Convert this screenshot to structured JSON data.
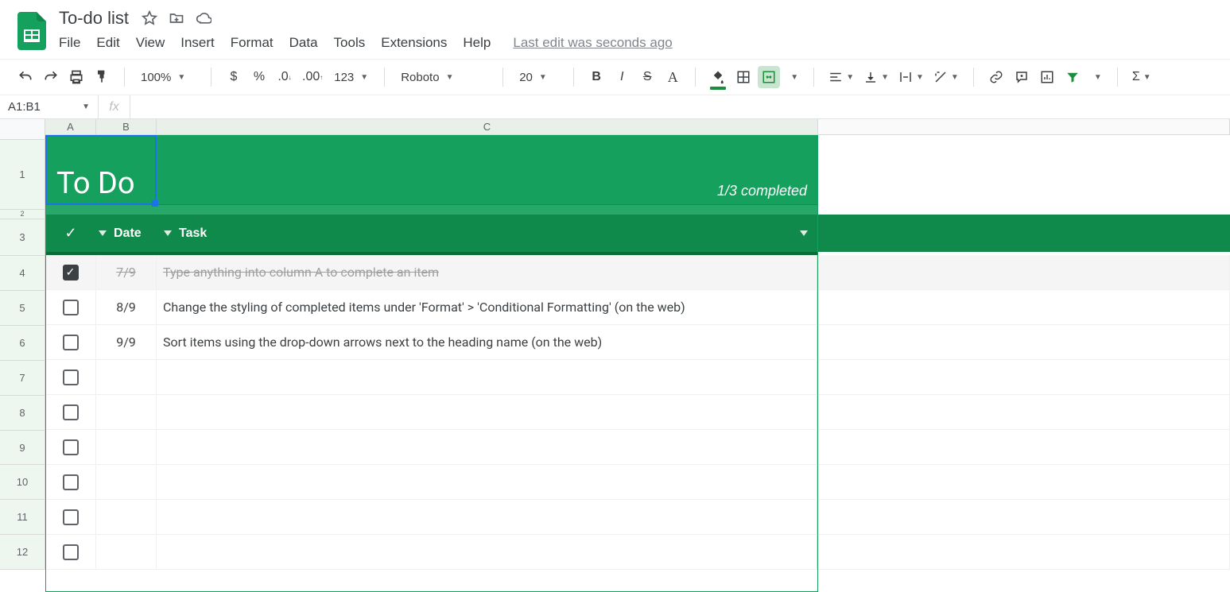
{
  "doc": {
    "title": "To-do list"
  },
  "menu": {
    "file": "File",
    "edit": "Edit",
    "view": "View",
    "insert": "Insert",
    "format": "Format",
    "data": "Data",
    "tools": "Tools",
    "extensions": "Extensions",
    "help": "Help",
    "last_edit": "Last edit was seconds ago"
  },
  "toolbar": {
    "zoom": "100%",
    "font": "Roboto",
    "font_size": "20",
    "fmt_123": "123"
  },
  "namebox": {
    "range": "A1:B1",
    "fx": "fx"
  },
  "columns": {
    "a": "A",
    "b": "B",
    "c": "C"
  },
  "row_headers": [
    "1",
    "2",
    "3",
    "4",
    "5",
    "6",
    "7",
    "8",
    "9",
    "10",
    "11",
    "12"
  ],
  "banner": {
    "title": "To Do",
    "status": "1/3 completed"
  },
  "headers": {
    "check": "✓",
    "date": "Date",
    "task": "Task"
  },
  "rows": [
    {
      "checked": true,
      "date": "7/9",
      "task": "Type anything into column A to complete an item"
    },
    {
      "checked": false,
      "date": "8/9",
      "task": "Change the styling of completed items under 'Format' > 'Conditional Formatting' (on the web)"
    },
    {
      "checked": false,
      "date": "9/9",
      "task": "Sort items using the drop-down arrows next to the heading name (on the web)"
    },
    {
      "checked": false,
      "date": "",
      "task": ""
    },
    {
      "checked": false,
      "date": "",
      "task": ""
    },
    {
      "checked": false,
      "date": "",
      "task": ""
    },
    {
      "checked": false,
      "date": "",
      "task": ""
    },
    {
      "checked": false,
      "date": "",
      "task": ""
    },
    {
      "checked": false,
      "date": "",
      "task": ""
    }
  ]
}
